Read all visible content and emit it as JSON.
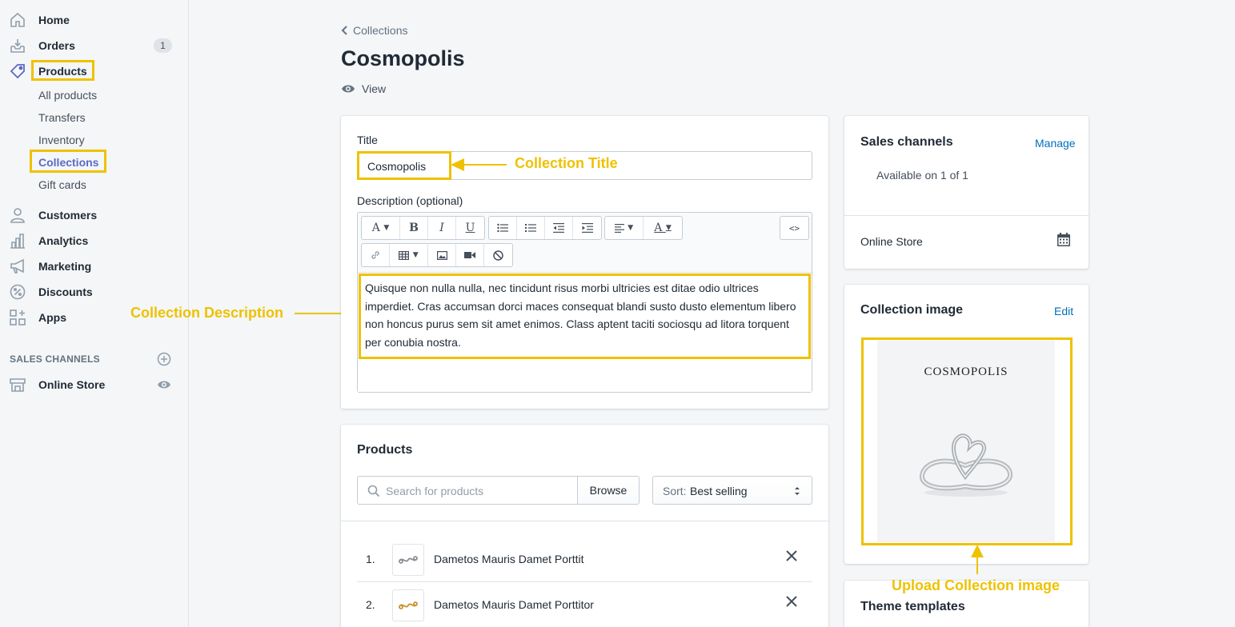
{
  "sidebar": {
    "items": [
      {
        "label": "Home"
      },
      {
        "label": "Orders",
        "badge": "1"
      },
      {
        "label": "Products"
      },
      {
        "label": "Customers"
      },
      {
        "label": "Analytics"
      },
      {
        "label": "Marketing"
      },
      {
        "label": "Discounts"
      },
      {
        "label": "Apps"
      }
    ],
    "product_subitems": [
      "All products",
      "Transfers",
      "Inventory",
      "Collections",
      "Gift cards"
    ],
    "sales_channels_heading": "SALES CHANNELS",
    "online_store": "Online Store"
  },
  "header": {
    "breadcrumb": "Collections",
    "title": "Cosmopolis",
    "view": "View"
  },
  "title_card": {
    "title_label": "Title",
    "title_value": "Cosmopolis",
    "description_label": "Description (optional)",
    "description_text": "Quisque non nulla nulla, nec tincidunt risus morbi ultricies est ditae odio ultrices imperdiet. Cras accumsan dorci maces consequat blandi susto dusto elementum libero non honcus purus sem sit amet enimos. Class aptent taciti sociosqu ad litora torquent per conubia nostra."
  },
  "products_card": {
    "heading": "Products",
    "search_placeholder": "Search for products",
    "browse": "Browse",
    "sort_prefix": "Sort:",
    "sort_value": "Best selling",
    "rows": [
      {
        "num": "1.",
        "name": "Dametos Mauris Damet Porttit"
      },
      {
        "num": "2.",
        "name": "Dametos Mauris Damet Porttitor"
      }
    ]
  },
  "sales_channels_card": {
    "heading": "Sales channels",
    "manage": "Manage",
    "availability": "Available on 1 of 1",
    "channel": "Online Store"
  },
  "collection_image_card": {
    "heading": "Collection image",
    "edit": "Edit",
    "image_text": "COSMOPOLIS"
  },
  "theme_card": {
    "heading": "Theme templates"
  },
  "annotations": {
    "title": "Collection Title",
    "description": "Collection Description",
    "image": "Upload Collection image"
  },
  "colors": {
    "highlight": "#eec200",
    "link": "#006fbb",
    "active_nav": "#5c6ac4"
  }
}
